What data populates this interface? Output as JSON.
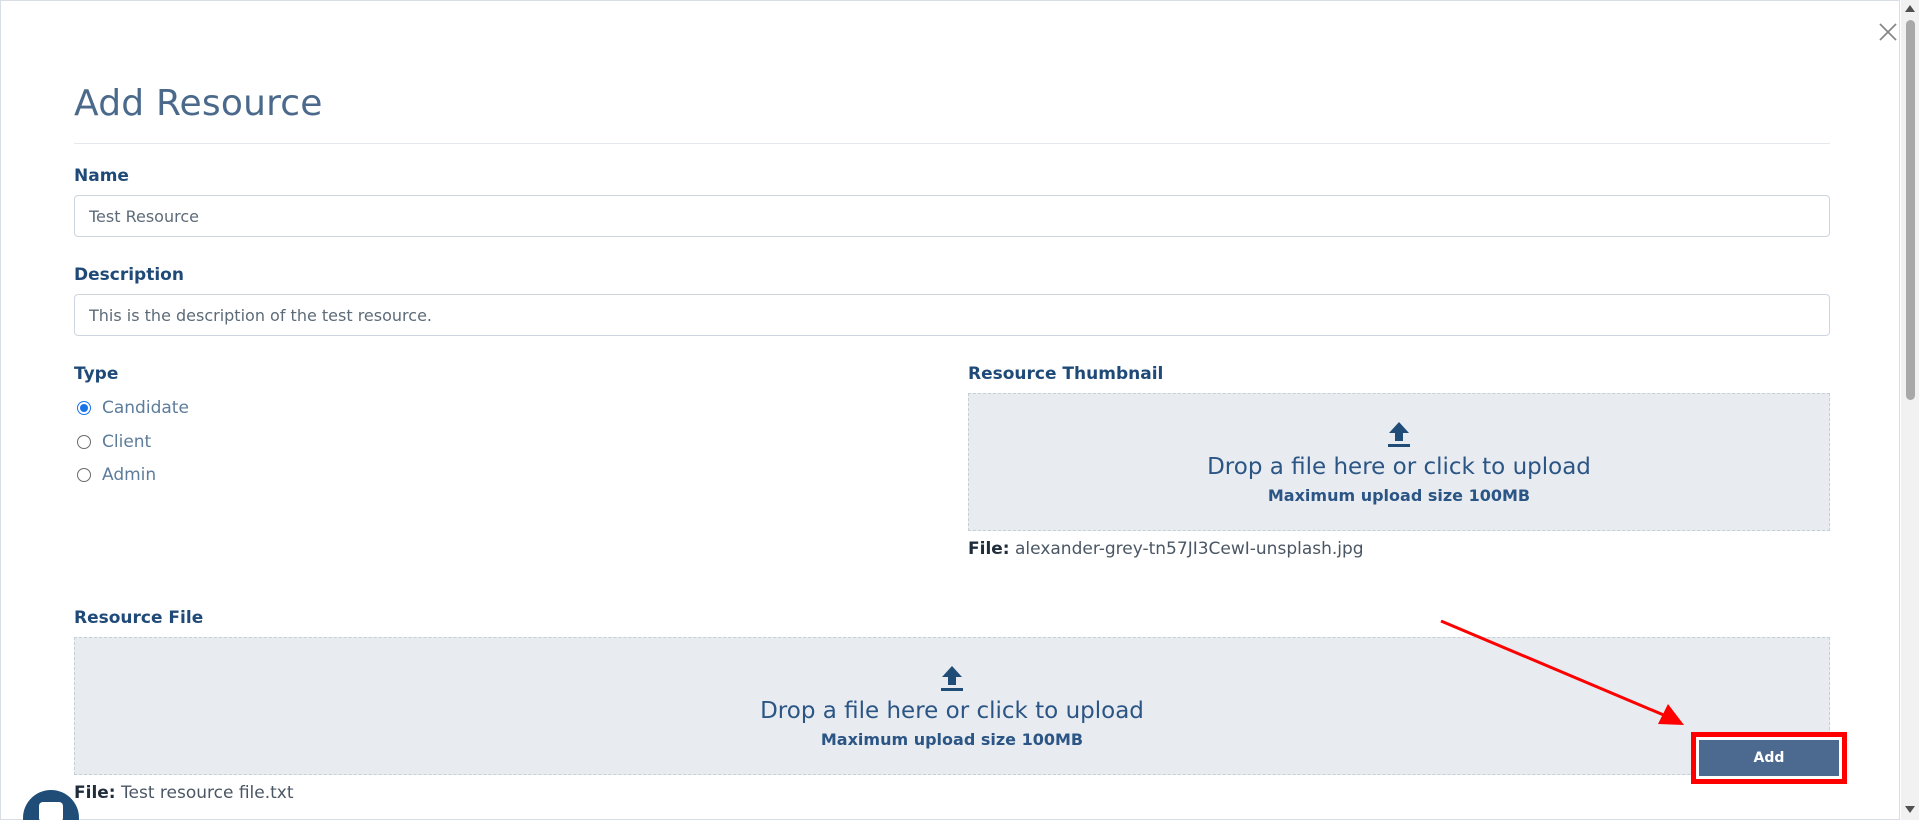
{
  "modal": {
    "title": "Add Resource"
  },
  "form": {
    "name": {
      "label": "Name",
      "value": "Test Resource"
    },
    "description": {
      "label": "Description",
      "value": "This is the description of the test resource."
    },
    "type": {
      "label": "Type",
      "options": [
        {
          "label": "Candidate",
          "checked": true
        },
        {
          "label": "Client",
          "checked": false
        },
        {
          "label": "Admin",
          "checked": false
        }
      ]
    },
    "thumbnail": {
      "label": "Resource Thumbnail",
      "drop_text": "Drop a file here or click to upload",
      "size_text": "Maximum upload size 100MB",
      "file_label": "File:",
      "file_name": "alexander-grey-tn57JI3CewI-unsplash.jpg"
    },
    "resource_file": {
      "label": "Resource File",
      "drop_text": "Drop a file here or click to upload",
      "size_text": "Maximum upload size 100MB",
      "file_label": "File:",
      "file_name": "Test resource file.txt"
    }
  },
  "actions": {
    "add_label": "Add"
  },
  "icons": {
    "close": "close-icon",
    "upload": "upload-icon",
    "chat": "chat-icon"
  },
  "colors": {
    "primary_text": "#1f4a78",
    "button_bg": "#4c6a8f",
    "highlight": "#ff0000",
    "dropzone_bg": "#e8ecf0"
  }
}
